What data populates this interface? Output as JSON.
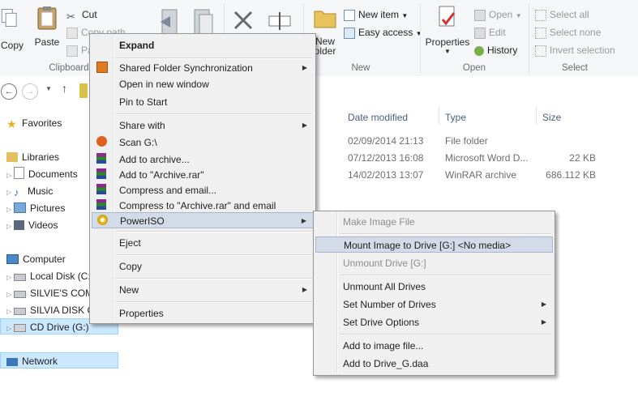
{
  "ribbon": {
    "copy": "Copy",
    "paste": "Paste",
    "cut": "Cut",
    "copy_path": "Copy path",
    "paste_shortcut": "Pa",
    "clipboard_group": "Clipboard",
    "new_folder": "New\nfolder",
    "new_folder_l1": "New",
    "new_folder_l2": "older",
    "new_item": "New item",
    "easy_access": "Easy access",
    "new_group": "New",
    "properties": "Properties",
    "open": "Open",
    "edit": "Edit",
    "history": "History",
    "open_group": "Open",
    "select_all": "Select all",
    "select_none": "Select none",
    "invert_selection": "Invert selection",
    "select_group": "Select"
  },
  "file_list": {
    "columns": [
      "Date modified",
      "Type",
      "Size"
    ],
    "rows": [
      {
        "date": "02/09/2014 21:13",
        "type": "File folder",
        "size": ""
      },
      {
        "date": "07/12/2013 16:08",
        "type": "Microsoft Word D...",
        "size": "22 KB"
      },
      {
        "date": "14/02/2013 13:07",
        "type": "WinRAR archive",
        "size": "686.112 KB"
      }
    ]
  },
  "nav": {
    "favorites": "Favorites",
    "libraries": "Libraries",
    "documents": "Documents",
    "music": "Music",
    "pictures": "Pictures",
    "videos": "Videos",
    "computer": "Computer",
    "local_disk": "Local Disk (C:",
    "silvies": "SILVIE'S COM",
    "silvia_disk": "SILVIA DISK C",
    "cd_drive": "CD Drive (G:)",
    "network": "Network"
  },
  "context_menu": {
    "items": [
      {
        "label": "Expand",
        "bold": true
      },
      {
        "label": "Shared Folder Synchronization",
        "submenu": true
      },
      {
        "label": "Open in new window"
      },
      {
        "label": "Pin to Start"
      },
      {
        "label": "Share with",
        "submenu": true
      },
      {
        "label": "Scan G:\\"
      },
      {
        "label": "Add to archive..."
      },
      {
        "label": "Add to \"Archive.rar\""
      },
      {
        "label": "Compress and email..."
      },
      {
        "label": "Compress to \"Archive.rar\" and email"
      },
      {
        "label": "PowerISO",
        "submenu": true,
        "highlighted": true
      },
      {
        "label": "Eject"
      },
      {
        "label": "Copy"
      },
      {
        "label": "New",
        "submenu": true
      },
      {
        "label": "Properties"
      }
    ]
  },
  "poweriso_menu": {
    "items": [
      {
        "label": "Make Image File",
        "disabled": true
      },
      {
        "label": "Mount Image to Drive [G:] <No media>",
        "highlighted": true
      },
      {
        "label": "Unmount Drive [G:]",
        "disabled": true
      },
      {
        "label": "Unmount All Drives"
      },
      {
        "label": "Set Number of Drives",
        "submenu": true
      },
      {
        "label": "Set Drive Options",
        "submenu": true
      },
      {
        "label": "Add to image file..."
      },
      {
        "label": "Add to Drive_G.daa"
      }
    ]
  },
  "colors": {
    "menu_bg": "#f0f0f0",
    "menu_highlight": "#d3dbe8",
    "selection_bg": "#cce8ff"
  }
}
